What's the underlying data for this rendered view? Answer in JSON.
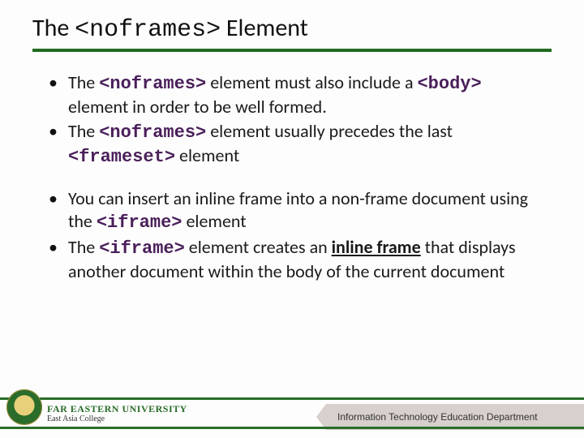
{
  "title": {
    "pre": "The ",
    "code": "<noframes>",
    "post": " Element"
  },
  "bullets_group1": [
    {
      "parts": [
        {
          "t": "text",
          "v": "The "
        },
        {
          "t": "code",
          "v": "<noframes>"
        },
        {
          "t": "text",
          "v": " element must also include a "
        },
        {
          "t": "code",
          "v": "<body>"
        },
        {
          "t": "text",
          "v": " element in order to be well formed."
        }
      ]
    },
    {
      "parts": [
        {
          "t": "text",
          "v": "The "
        },
        {
          "t": "code",
          "v": "<noframes>"
        },
        {
          "t": "text",
          "v": " element usually precedes the last "
        },
        {
          "t": "code",
          "v": "<frameset>"
        },
        {
          "t": "text",
          "v": " element"
        }
      ]
    }
  ],
  "bullets_group2": [
    {
      "parts": [
        {
          "t": "text",
          "v": "You can insert an inline frame into a non-frame document using the "
        },
        {
          "t": "code",
          "v": "<iframe>"
        },
        {
          "t": "text",
          "v": " element"
        }
      ]
    },
    {
      "parts": [
        {
          "t": "text",
          "v": "The "
        },
        {
          "t": "code",
          "v": "<iframe>"
        },
        {
          "t": "text",
          "v": " element creates an "
        },
        {
          "t": "emph",
          "v": "inline frame"
        },
        {
          "t": "text",
          "v": " that displays another document within the body of the current document"
        }
      ]
    }
  ],
  "footer": {
    "university": "FAR EASTERN UNIVERSITY",
    "college": "East Asia College",
    "department": "Information Technology Education Department"
  }
}
